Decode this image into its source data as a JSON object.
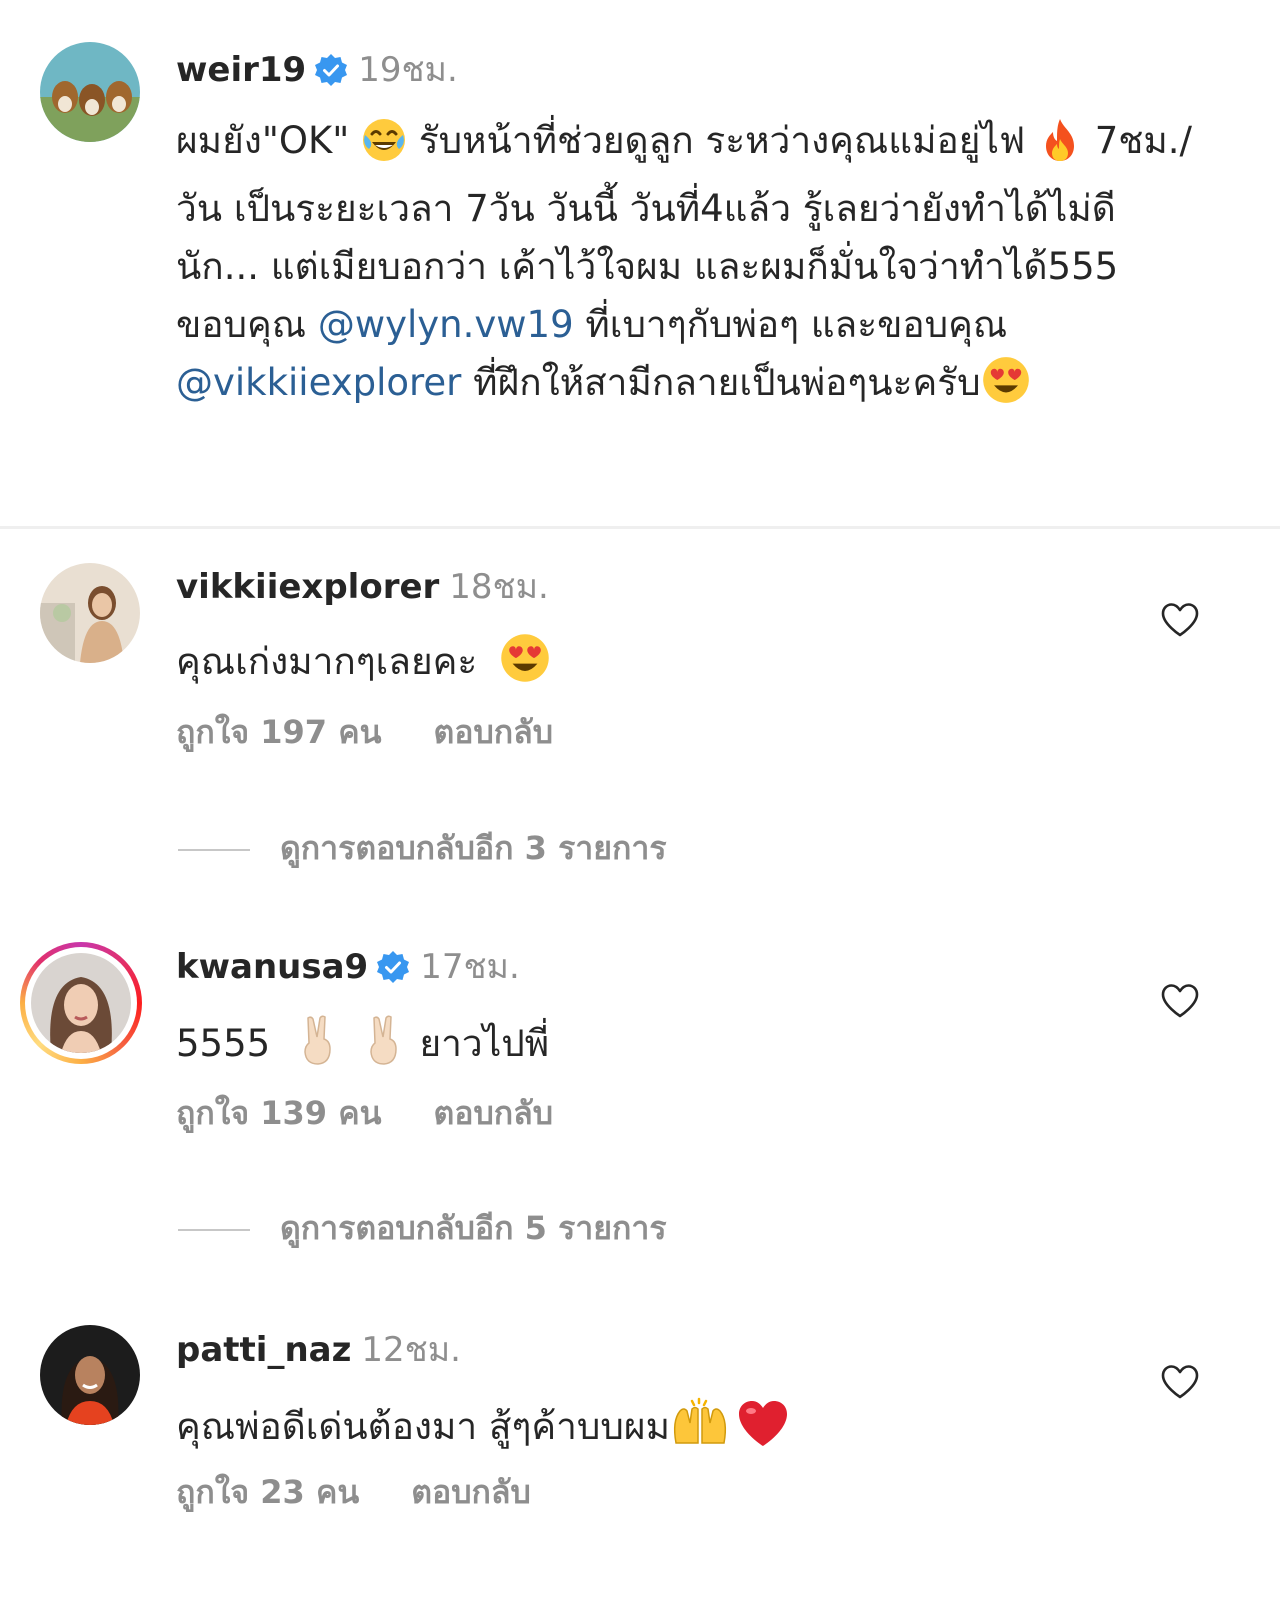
{
  "post": {
    "username": "weir19",
    "time": "19ชม.",
    "verified": true,
    "caption": {
      "part1": "ผมยัง\"OK\"",
      "part2": "รับหน้าที่ช่วยดูลูก ระหว่างคุณแม่อยู่ไฟ",
      "part3": "7ชม./วัน เป็นระยะเวลา 7วัน วันนี้ วันที่4แล้ว รู้เลยว่ายังทำได้ไม่ดีนัก... แต่เมียบอกว่า เค้าไว้ใจผม และผมก็มั่นใจว่าทำได้555 ขอบคุณ",
      "mention1": "@wylyn.vw19",
      "part4": "ที่เบาๆกับพ่อๆ และขอบคุณ",
      "mention2": "@vikkiiexplorer",
      "part5": "ที่ฝึกให้สามีกลายเป็นพ่อๆนะครับ"
    }
  },
  "comments": [
    {
      "username": "vikkiiexplorer",
      "time": "18ชม.",
      "verified": false,
      "text": "คุณเก่งมากๆเลยคะ",
      "likes": "ถูกใจ 197 คน",
      "reply": "ตอบกลับ",
      "view_replies": "ดูการตอบกลับอีก 3 รายการ"
    },
    {
      "username": "kwanusa9",
      "time": "17ชม.",
      "verified": true,
      "text_before": "5555",
      "text_after": "ยาวไปพี่",
      "likes": "ถูกใจ 139 คน",
      "reply": "ตอบกลับ",
      "view_replies": "ดูการตอบกลับอีก 5 รายการ",
      "story_ring": true
    },
    {
      "username": "patti_naz",
      "time": "12ชม.",
      "verified": false,
      "text": "คุณพ่อดีเด่นต้องมา สู้ๆค้าบบผม",
      "likes": "ถูกใจ 23 คน",
      "reply": "ตอบกลับ"
    }
  ],
  "icons": {
    "heart": "heart-outline-icon",
    "verified": "verified-badge-icon",
    "emoji_laugh": "tears-of-joy-emoji",
    "emoji_fire": "fire-emoji",
    "emoji_hearteyes": "heart-eyes-emoji",
    "emoji_victory": "victory-hand-emoji",
    "emoji_raised_hands": "raising-hands-emoji",
    "emoji_red_heart": "red-heart-emoji"
  },
  "colors": {
    "username": "#262626",
    "muted": "#8e8e8e",
    "mention": "#2b5f94",
    "verified": "#3897f0",
    "divider": "#efefef"
  }
}
